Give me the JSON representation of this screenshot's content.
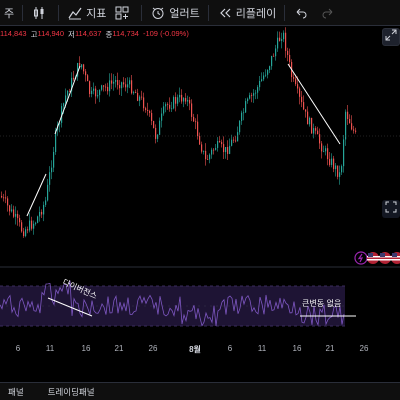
{
  "toolbar": {
    "left_partial": "주",
    "indicators_label": "지표",
    "alert_label": "얼러트",
    "replay_label": "리플레이"
  },
  "ohlc": {
    "open_value": "114,843",
    "high_label": "고",
    "high_value": "114,940",
    "low_label": "저",
    "low_value": "114,637",
    "close_label": "종",
    "close_value": "114,734",
    "change": "-109 (-0.09%)"
  },
  "annotations": {
    "divergence_text": "다이버전스",
    "no_big_change_text": "큰변동 없음"
  },
  "x_axis": {
    "ticks": [
      "6",
      "11",
      "16",
      "21",
      "26",
      "8월",
      "6",
      "11",
      "16",
      "21",
      "26"
    ]
  },
  "bottom_panel": {
    "left_partial": "패널",
    "trading_panel": "트레이딩패널"
  },
  "colors": {
    "up": "#26a69a",
    "down": "#ef5350",
    "rsi_line": "#7e57c2",
    "rsi_band": "#1e1434",
    "trend_line": "#ffffff"
  }
}
